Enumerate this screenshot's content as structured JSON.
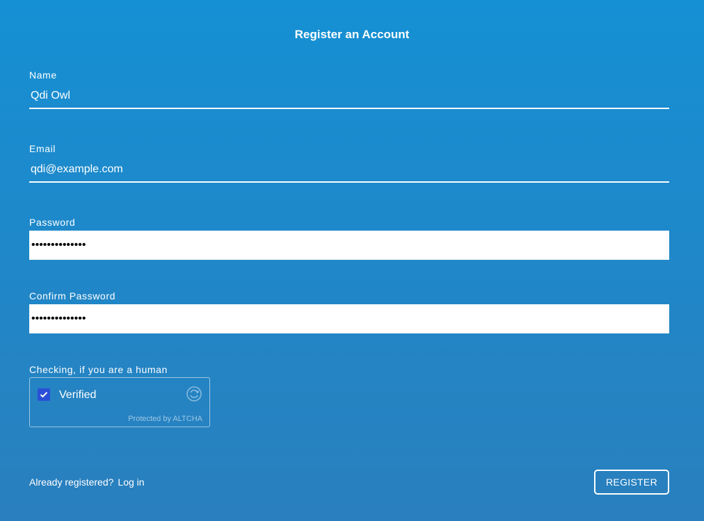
{
  "header": {
    "title": "Register an Account"
  },
  "form": {
    "name": {
      "label": "Name",
      "value": "Qdi Owl"
    },
    "email": {
      "label": "Email",
      "value": "qdi@example.com"
    },
    "password": {
      "label": "Password",
      "value": "••••••••••••••"
    },
    "confirm_password": {
      "label": "Confirm Password",
      "value": "••••••••••••••"
    }
  },
  "captcha": {
    "label": "Checking, if you are a human",
    "status": "Verified",
    "checked": true,
    "footer": "Protected by ALTCHA",
    "icon": "refresh-icon"
  },
  "footer": {
    "prompt": "Already registered?",
    "login_link": "Log in",
    "register_button": "REGISTER"
  },
  "colors": {
    "background_top": "#1590d4",
    "background_bottom": "#2a7fbd",
    "checkbox": "#2a4fd6"
  }
}
